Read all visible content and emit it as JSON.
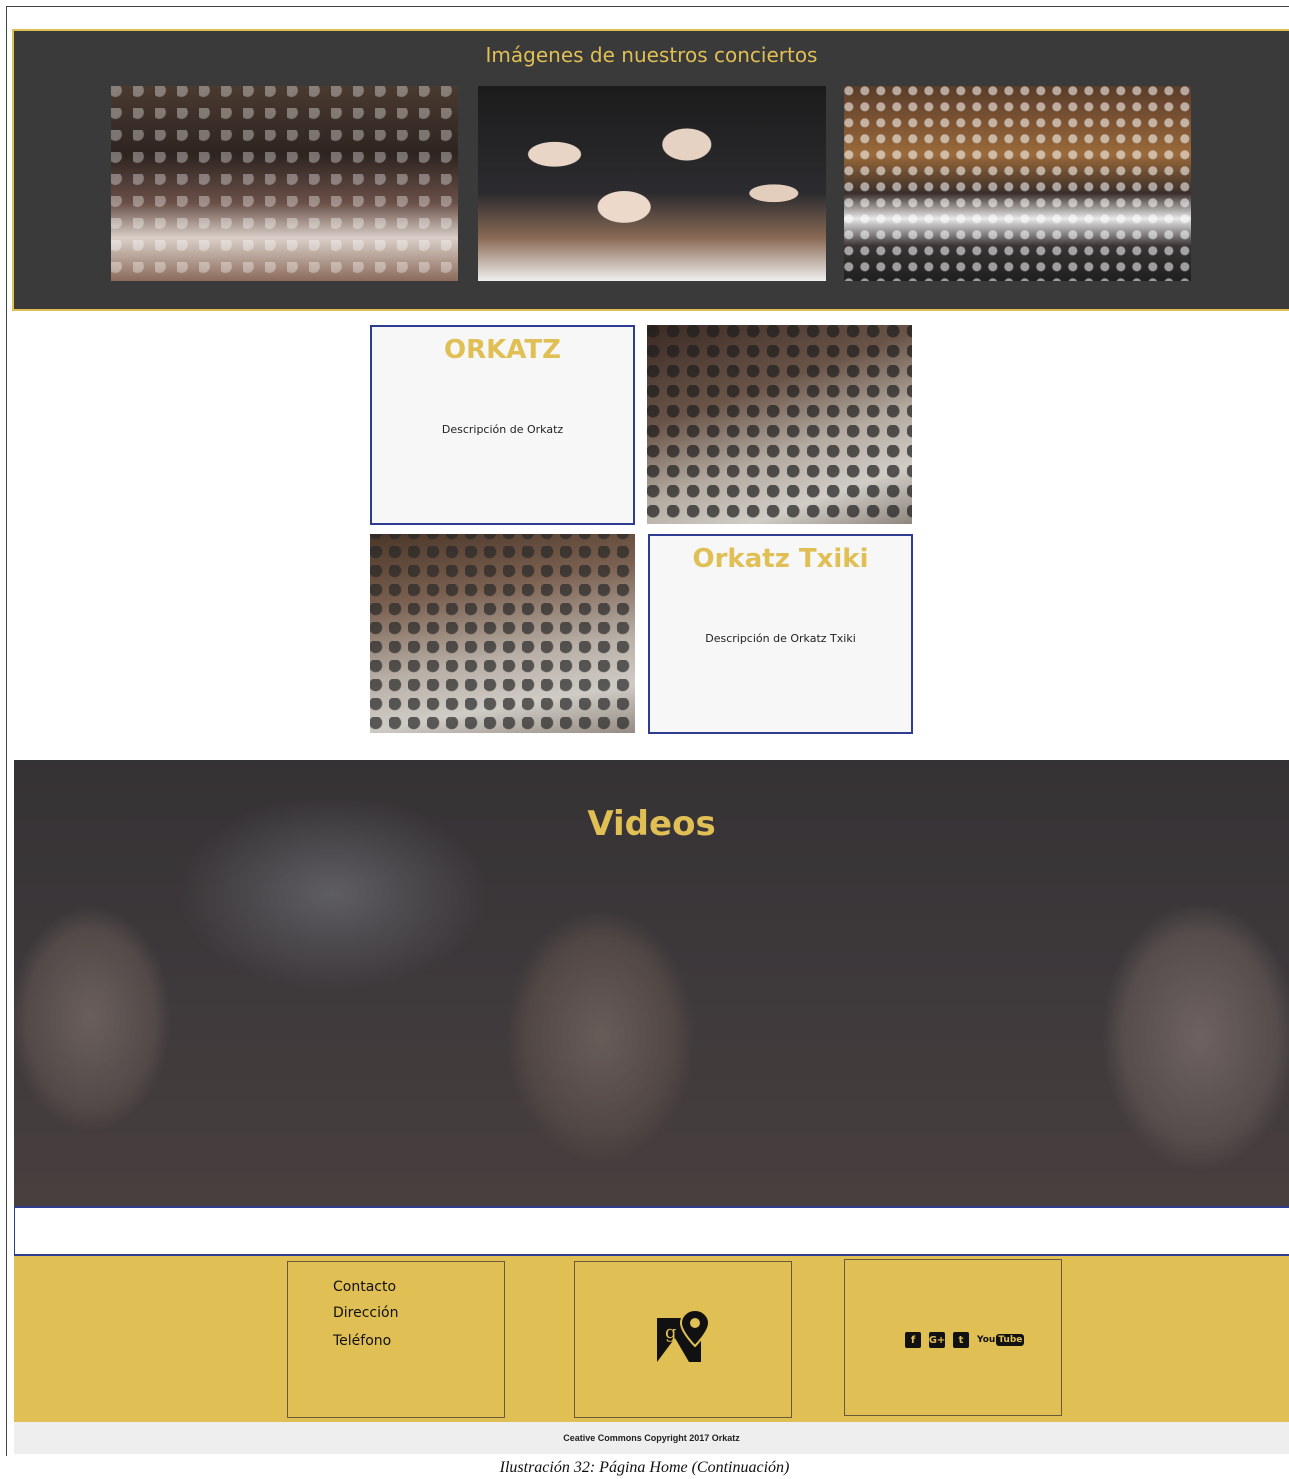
{
  "gallery": {
    "title": "Imágenes de nuestros conciertos"
  },
  "cards": [
    {
      "title": "ORKATZ",
      "description": "Descripción de Orkatz"
    },
    {
      "title": "Orkatz Txiki",
      "description": "Descripción de Orkatz Txiki"
    }
  ],
  "videos": {
    "title": "Videos"
  },
  "footer": {
    "contact": [
      "Contacto",
      "Dirección",
      "Teléfono"
    ],
    "maps_icon": "google-maps-icon",
    "social": {
      "facebook": "f",
      "googleplus": "G+",
      "twitter": "t",
      "youtube_you": "You",
      "youtube_tube": "Tube"
    }
  },
  "copyright": "Ceative Commons Copyright 2017 Orkatz",
  "caption": "Ilustración 32: Página Home (Continuación)",
  "colors": {
    "accent": "#e0bf55",
    "dark": "#3a3a3a",
    "border_blue": "#2e3d8f"
  }
}
